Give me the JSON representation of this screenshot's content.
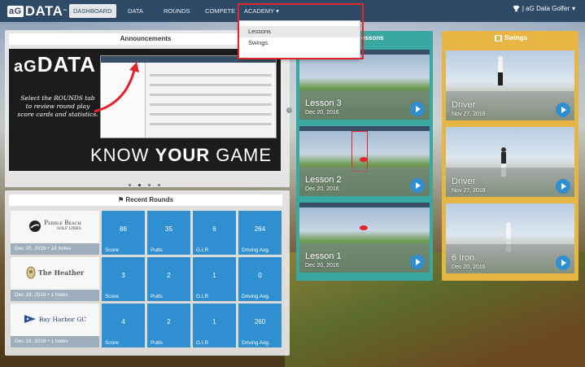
{
  "nav": {
    "logo": "DATA",
    "logo_ag": "aG",
    "items": [
      "DASHBOARD",
      "DATA",
      "ROUNDS",
      "COMPETE",
      "ACADEMY"
    ],
    "user": "| aG Data Golfer"
  },
  "academy_menu": [
    "Lessons",
    "Swings"
  ],
  "announcements": {
    "title": "Announcements",
    "slide_logo": "DATA",
    "slide_logo_ag": "aG",
    "slide_text": "Select the ROUNDS tab to review round play score cards and statistics.",
    "slide_footer_a": "KNOW ",
    "slide_footer_b": "YOUR",
    "slide_footer_c": " GAME"
  },
  "recent_rounds": {
    "title": "Recent Rounds",
    "rounds": [
      {
        "course": "Pebble Beach",
        "course_sub": "GOLF LINKS",
        "date": "Dec 20, 2016 • 18 holes",
        "stats": [
          {
            "v": "86",
            "l": "Score"
          },
          {
            "v": "35",
            "l": "Putts"
          },
          {
            "v": "6",
            "l": "G.I.R"
          },
          {
            "v": "264",
            "l": "Driving Avg."
          }
        ]
      },
      {
        "course": "The Heather",
        "course_sub": "",
        "date": "Dec 19, 2016 • 1 holes",
        "stats": [
          {
            "v": "3",
            "l": "Score"
          },
          {
            "v": "2",
            "l": "Putts"
          },
          {
            "v": "1",
            "l": "G.I.R"
          },
          {
            "v": "0",
            "l": "Driving Avg."
          }
        ]
      },
      {
        "course": "Bay Harbor GC",
        "course_sub": "",
        "date": "Dec 19, 2016 • 1 holes",
        "stats": [
          {
            "v": "4",
            "l": "Score"
          },
          {
            "v": "2",
            "l": "Putts"
          },
          {
            "v": "1",
            "l": "G.I.R"
          },
          {
            "v": "260",
            "l": "Driving Avg."
          }
        ]
      }
    ]
  },
  "lessons": {
    "title": "essons",
    "items": [
      {
        "name": "Lesson 3",
        "date": "Dec 20, 2016"
      },
      {
        "name": "Lesson 2",
        "date": "Dec 20, 2016"
      },
      {
        "name": "Lesson 1",
        "date": "Dec 20, 2016"
      }
    ]
  },
  "swings": {
    "title": "Swings",
    "items": [
      {
        "name": "Driver",
        "date": "Nov 27, 2018"
      },
      {
        "name": "Driver",
        "date": "Nov 27, 2018"
      },
      {
        "name": "6 Iron",
        "date": "Dec 20, 2016"
      }
    ]
  },
  "colors": {
    "nav": "#2f4a66",
    "accent_blue": "#2f8fd0",
    "lessons_border": "#3aa7a0",
    "swings_border": "#e7b543",
    "highlight": "#e0262c"
  }
}
